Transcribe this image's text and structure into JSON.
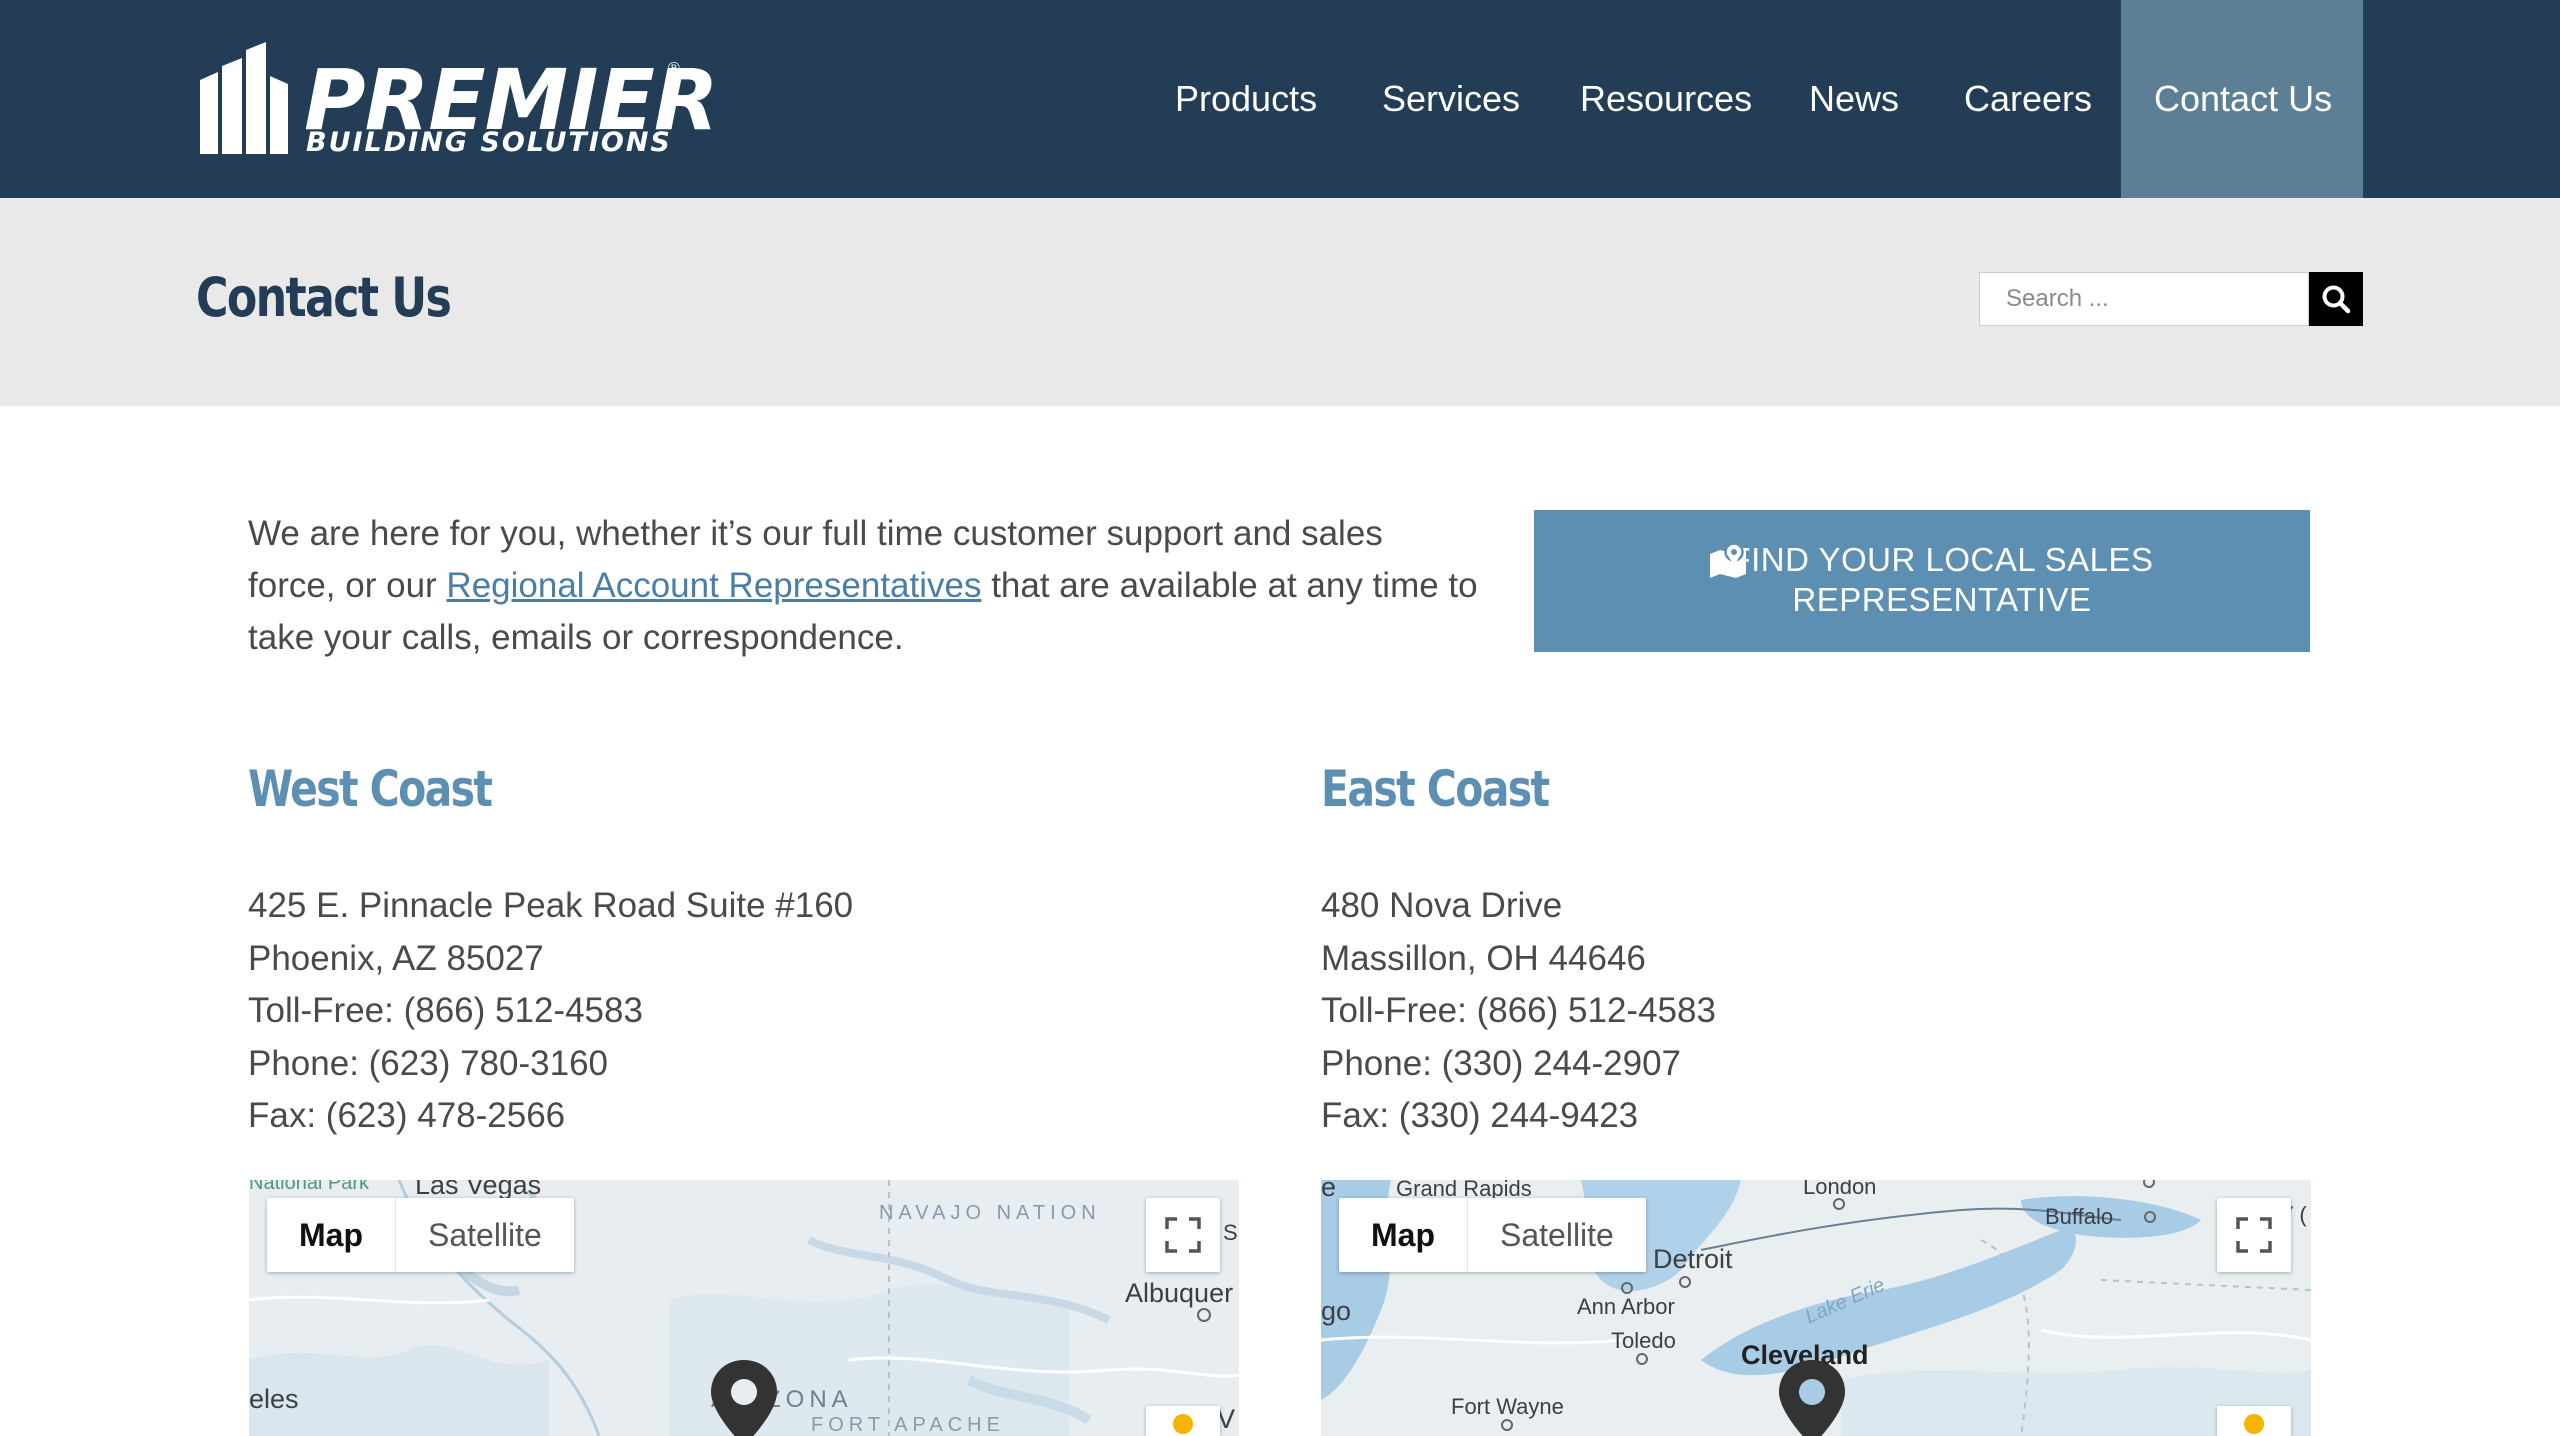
{
  "header": {
    "logo": {
      "word": "PREMIER",
      "sub": "BUILDING SOLUTIONS",
      "reg": "®"
    },
    "nav": [
      {
        "label": "Products"
      },
      {
        "label": "Services"
      },
      {
        "label": "Resources"
      },
      {
        "label": "News"
      },
      {
        "label": "Careers"
      },
      {
        "label": "Contact Us",
        "active": true
      }
    ]
  },
  "titlebar": {
    "title": "Contact Us",
    "search": {
      "placeholder": "Search ...",
      "value": ""
    }
  },
  "intro": {
    "text_before": "We are here for you, whether it’s our full time customer support and sales force, or our ",
    "link": "Regional Account Representatives",
    "text_after": " that are available at any time to take your calls, emails or correspondence.",
    "cta": {
      "line1": "FIND YOUR LOCAL SALES",
      "line2": "REPRESENTATIVE"
    }
  },
  "locations": [
    {
      "title": "West Coast",
      "lines": [
        "425 E. Pinnacle Peak Road Suite #160",
        "Phoenix, AZ 85027",
        "Toll-Free: (866) 512-4583",
        "Phone: (623) 780-3160",
        "Fax: (623) 478-2566"
      ]
    },
    {
      "title": "East Coast",
      "lines": [
        "480 Nova Drive",
        "Massillon, OH 44646",
        "Toll-Free: (866) 512-4583",
        "Phone: (330) 244-2907",
        "Fax: (330) 244-9423"
      ]
    }
  ],
  "maps": [
    {
      "toggle": {
        "map": "Map",
        "satellite": "Satellite"
      },
      "labels": {
        "park": "National Park",
        "city1": "Las Vegas",
        "region": "NAVAJO NATION",
        "city2": "Albuquer",
        "city3": "eles",
        "state": "ARIZONA",
        "region2": "FORT APACHE",
        "edge1": "S",
        "edge2": "V"
      }
    },
    {
      "toggle": {
        "map": "Map",
        "satellite": "Satellite"
      },
      "labels": {
        "edge1": "e",
        "city1": "Grand Rapids",
        "city2": "London",
        "city3": "Buffalo",
        "edge2": "Y (",
        "city4": "Detroit",
        "edge3": "go",
        "city5": "Ann Arbor",
        "lake": "Lake Erie",
        "city6": "Toledo",
        "city7": "Cleveland",
        "city8": "Fort Wayne"
      }
    }
  ],
  "colors": {
    "header_bg": "#223d55",
    "nav_active": "#5d7f96",
    "accent": "#5d8fb2",
    "link": "#4a7ea6",
    "titlebar_bg": "#e9e9e9"
  }
}
